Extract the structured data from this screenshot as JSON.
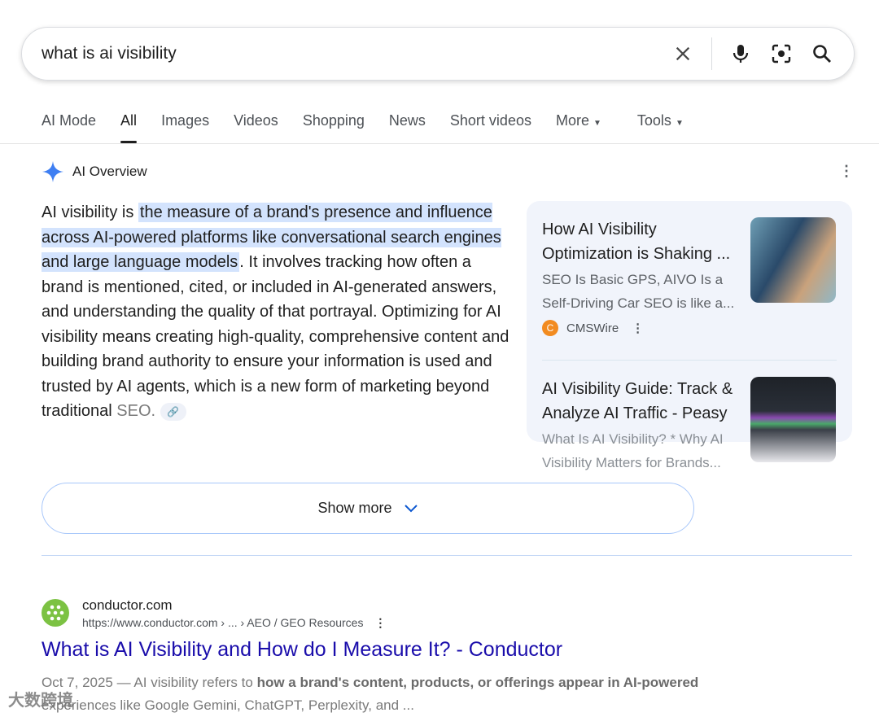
{
  "search": {
    "query": "what is ai visibility"
  },
  "tabs": [
    "AI Mode",
    "All",
    "Images",
    "Videos",
    "Shopping",
    "News",
    "Short videos",
    "More",
    "Tools"
  ],
  "overview": {
    "title": "AI Overview",
    "text_before": "AI visibility is ",
    "highlight": "the measure of a brand's presence and influence across AI-powered platforms like conversational search engines and large language models",
    "text_after": ". It involves tracking how often a brand is mentioned, cited, or included in AI-generated answers, and understanding the quality of that portrayal. Optimizing for AI visibility means creating high-quality, comprehensive content and building brand authority to ensure your information is used and trusted by AI agents, which is a new form of marketing beyond traditional ",
    "text_end": "SEO.",
    "show_more": "Show more"
  },
  "cards": [
    {
      "title": "How AI Visibility Optimization is Shaking ...",
      "desc": "SEO Is Basic GPS, AIVO Is a Self-Driving Car SEO is like a...",
      "source": "CMSWire",
      "source_color": "#f28b20"
    },
    {
      "title": "AI Visibility Guide: Track & Analyze AI Traffic - Peasy",
      "desc": "What Is AI Visibility? * Why AI Visibility Matters for Brands..."
    }
  ],
  "result": {
    "site": "conductor.com",
    "url": "https://www.conductor.com › ... › AEO / GEO Resources",
    "title": "What is AI Visibility and How do I Measure It? - Conductor",
    "date": "Oct 7, 2025 — ",
    "snip1": "AI visibility refers to ",
    "snip_bold": "how a brand's content, products, or offerings appear in AI-powered",
    "snip2": " experiences like Google Gemini, ChatGPT, Perplexity, and ..."
  },
  "watermark": "大数跨境"
}
